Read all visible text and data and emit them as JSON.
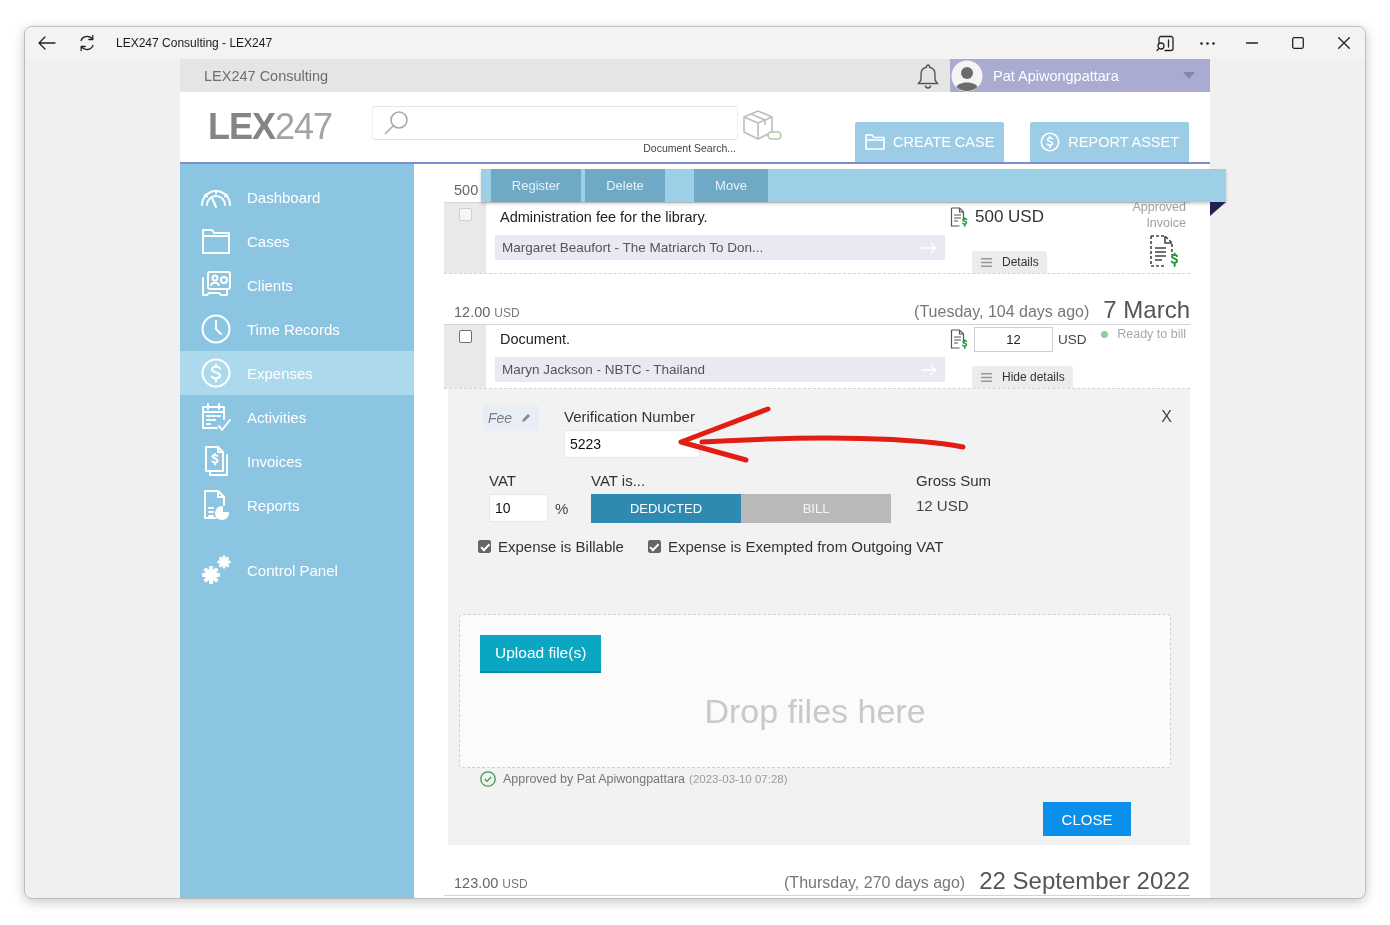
{
  "window": {
    "title": "LEX247 Consulting - LEX247"
  },
  "top_bar": {
    "firm": "LEX247 Consulting",
    "user": {
      "name": "Pat Apiwongpattara"
    }
  },
  "header": {
    "logo": "**LEX**247",
    "search": {
      "caption": "Document Search..."
    },
    "buttons": [
      {
        "label": "CREATE CASE"
      },
      {
        "label": "REPORT ASSET"
      }
    ]
  },
  "sidebar": {
    "items": [
      {
        "label": "Dashboard",
        "selected": false
      },
      {
        "label": "Cases",
        "selected": false
      },
      {
        "label": "Clients",
        "selected": false
      },
      {
        "label": "Time Records",
        "selected": false
      },
      {
        "label": "Expenses",
        "selected": true
      },
      {
        "label": "Activities",
        "selected": false
      },
      {
        "label": "Invoices",
        "selected": false
      },
      {
        "label": "Reports",
        "selected": false
      }
    ],
    "footer_items": [
      {
        "label": "Control Panel",
        "selected": false
      }
    ]
  },
  "toolbar": {
    "buttons": [
      {
        "label": "Register",
        "disabled": true
      },
      {
        "label": "Delete",
        "disabled": true
      },
      {
        "label": "Move",
        "disabled": true
      }
    ]
  },
  "groups": [
    {
      "amount": "500",
      "expenses": [
        {
          "checkbox": {
            "checked": false,
            "disabled": true
          },
          "description": "Administration fee for the library.",
          "case": "Margaret Beaufort - The Matriarch To Don...",
          "amount": {
            "kind": "text",
            "text": "500 USD"
          },
          "status": {
            "kind": "invoice",
            "lines": [
              "Approved",
              "Invoice"
            ]
          },
          "toggle": "Details"
        }
      ]
    },
    {
      "amount": "12.00",
      "currency": "USD",
      "relative": "(Tuesday, 104 days ago)",
      "date": "7 March",
      "expenses": [
        {
          "checkbox": {
            "checked": false,
            "disabled": false
          },
          "description": "Document.",
          "case": "Maryn Jackson - NBTC - Thailand",
          "amount": {
            "kind": "input",
            "value": "12",
            "currency": "USD"
          },
          "status": {
            "kind": "dot",
            "label": "Ready to bill",
            "color": "#8fce9c"
          },
          "toggle": "Hide details",
          "details": {
            "tag": "Fee",
            "verification": {
              "label": "Verification Number",
              "value": "5223"
            },
            "close_mark": "X",
            "vat": {
              "label": "VAT",
              "value": "10",
              "unit": "%"
            },
            "vat_mode": {
              "label": "VAT is...",
              "options": [
                {
                  "label": "DEDUCTED",
                  "selected": true
                },
                {
                  "label": "BILL",
                  "selected": false
                }
              ]
            },
            "gross": {
              "label": "Gross Sum",
              "value": "12 USD"
            },
            "checkboxes": [
              {
                "label": "Expense is Billable",
                "checked": true
              },
              {
                "label": "Expense is Exempted from Outgoing VAT",
                "checked": true
              }
            ],
            "upload": {
              "button": "Upload file(s)",
              "drop_text": "Drop files here"
            },
            "approval": {
              "text": "Approved by Pat Apiwongpattara",
              "time": "(2023-03-10 07:28)"
            },
            "close_button": "CLOSE"
          }
        }
      ]
    },
    {
      "amount": "123.00",
      "currency": "USD",
      "relative": "(Thursday, 270 days ago)",
      "date": "22 September 2022"
    }
  ]
}
